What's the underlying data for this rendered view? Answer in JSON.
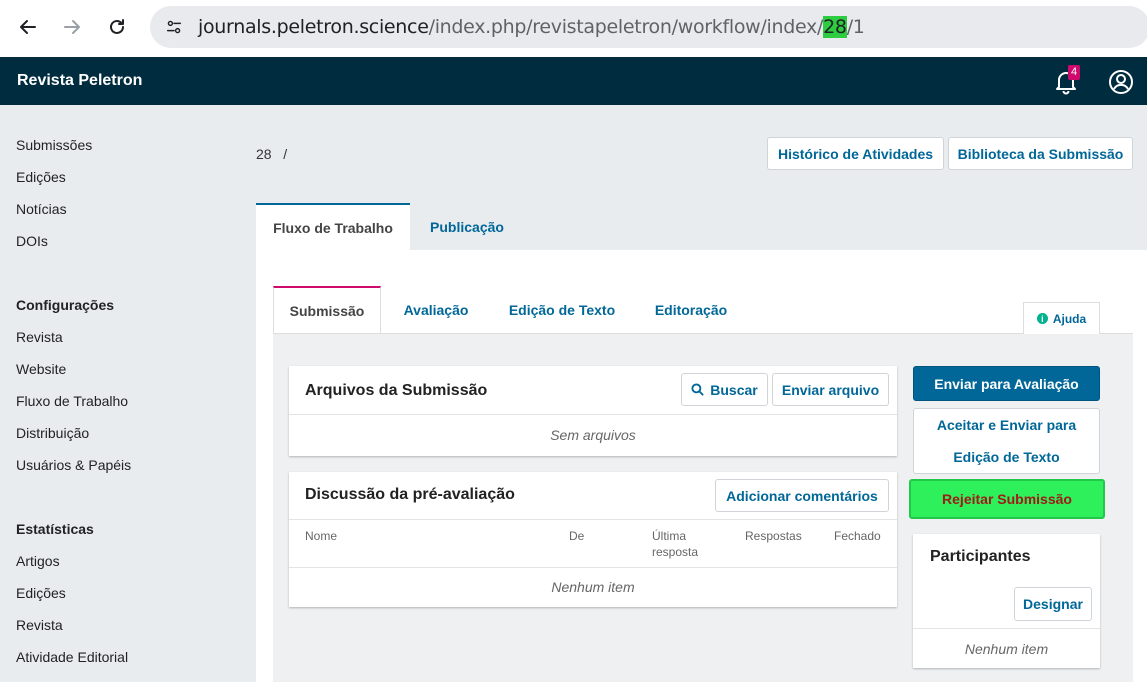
{
  "browser": {
    "url_host": "journals.peletron.science",
    "url_path_prefix": "/index.php/revistapeletron/workflow/index/",
    "url_highlight": "28",
    "url_suffix": "/1",
    "highlight_color": "#2ecc40"
  },
  "header": {
    "title": "Revista Peletron",
    "notifications_count": "4",
    "bg_color": "#002c40"
  },
  "sidebar": {
    "items_main": [
      "Submissões",
      "Edições",
      "Notícias",
      "DOIs"
    ],
    "config_heading": "Configurações",
    "items_config": [
      "Revista",
      "Website",
      "Fluxo de Trabalho",
      "Distribuição",
      "Usuários & Papéis"
    ],
    "stats_heading": "Estatísticas",
    "items_stats": [
      "Artigos",
      "Edições",
      "Revista",
      "Atividade Editorial"
    ]
  },
  "main": {
    "breadcrumb_id": "28",
    "breadcrumb_sep": "/",
    "history_btn": "Histórico de Atividades",
    "library_btn": "Biblioteca da Submissão",
    "tabs": [
      "Fluxo de Trabalho",
      "Publicação"
    ],
    "subtabs": [
      "Submissão",
      "Avaliação",
      "Edição de Texto",
      "Editoração"
    ],
    "help_label": "Ajuda"
  },
  "files_card": {
    "title": "Arquivos da Submissão",
    "search_btn": "Buscar",
    "upload_btn": "Enviar arquivo",
    "empty": "Sem arquivos"
  },
  "discussion_card": {
    "title": "Discussão da pré-avaliação",
    "add_btn": "Adicionar comentários",
    "columns": [
      "Nome",
      "De",
      "Última resposta",
      "Respostas",
      "Fechado"
    ],
    "empty": "Nenhum item"
  },
  "actions": {
    "send_review": "Enviar para Avaliação",
    "accept_line1": "Aceitar e Enviar para",
    "accept_line2": "Edição de Texto",
    "reject": "Rejeitar Submissão"
  },
  "participants": {
    "title": "Participantes",
    "assign_btn": "Designar",
    "empty": "Nenhum item"
  }
}
